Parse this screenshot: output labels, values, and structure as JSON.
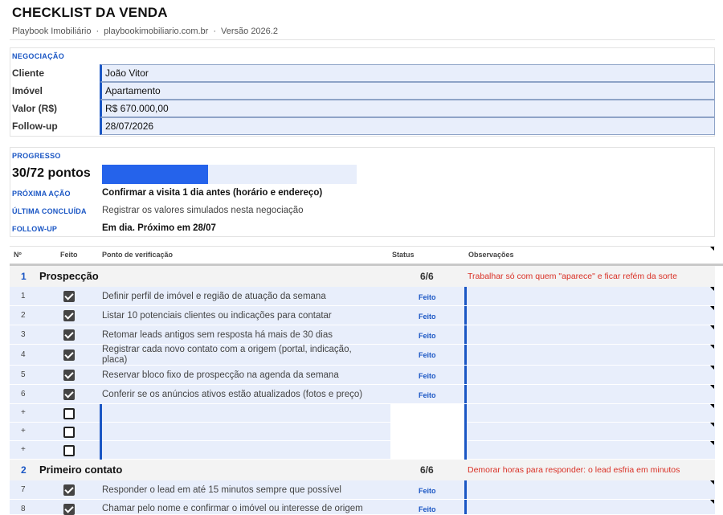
{
  "header": {
    "title": "CHECKLIST DA VENDA",
    "brand": "Playbook Imobiliário",
    "site": "playbookimobiliario.com.br",
    "version": "Versão 2026.2",
    "separator": "·"
  },
  "negociacao": {
    "label": "NEGOCIAÇÃO",
    "fields": [
      {
        "label": "Cliente",
        "value": "João Vitor"
      },
      {
        "label": "Imóvel",
        "value": "Apartamento"
      },
      {
        "label": "Valor (R$)",
        "value": "R$ 670.000,00"
      },
      {
        "label": "Follow-up",
        "value": "28/07/2026"
      }
    ]
  },
  "progresso": {
    "label": "PROGRESSO",
    "points": "30/72 pontos",
    "fraction": 0.4167,
    "proxima_acao_label": "PRÓXIMA AÇÃO",
    "proxima_acao": "Confirmar a visita 1 dia antes (horário e endereço)",
    "ultima_label": "ÚLTIMA CONCLUÍDA",
    "ultima": "Registrar os valores simulados nesta negociação",
    "followup_label": "FOLLOW-UP",
    "followup": "Em dia. Próximo em 28/07"
  },
  "table": {
    "headers": {
      "num": "Nº",
      "feito": "Feito",
      "ponto": "Ponto de verificação",
      "status": "Status",
      "obs": "Observações"
    },
    "groups": [
      {
        "num": "1",
        "name": "Prospecção",
        "score": "6/6",
        "warning": "Trabalhar só com quem \"aparece\" e ficar refém da sorte",
        "items": [
          {
            "n": "1",
            "text": "Definir perfil de imóvel e região de atuação da semana",
            "status": "Feito"
          },
          {
            "n": "2",
            "text": "Listar 10 potenciais clientes ou indicações para contatar",
            "status": "Feito"
          },
          {
            "n": "3",
            "text": "Retomar leads antigos sem resposta há mais de 30 dias",
            "status": "Feito"
          },
          {
            "n": "4",
            "text": "Registrar cada novo contato com a origem (portal, indicação, placa)",
            "status": "Feito"
          },
          {
            "n": "5",
            "text": "Reservar bloco fixo de prospecção na agenda da semana",
            "status": "Feito"
          },
          {
            "n": "6",
            "text": "Conferir se os anúncios ativos estão atualizados (fotos e preço)",
            "status": "Feito"
          }
        ],
        "empty_rows": [
          "+",
          "+",
          "+"
        ]
      },
      {
        "num": "2",
        "name": "Primeiro contato",
        "score": "6/6",
        "warning": "Demorar horas para responder: o lead esfria em minutos",
        "items": [
          {
            "n": "7",
            "text": "Responder o lead em até 15 minutos sempre que possível",
            "status": "Feito"
          },
          {
            "n": "8",
            "text": "Chamar pelo nome e confirmar o imóvel ou interesse de origem",
            "status": "Feito"
          }
        ]
      }
    ]
  },
  "icons": {
    "checked": "checkbox-checked-icon",
    "unchecked": "checkbox-empty-icon",
    "note": "comment-corner-icon"
  },
  "colors": {
    "accent": "#1a56c4",
    "progress": "#2563eb",
    "cell_fill": "#e8eefb",
    "warning": "#d93025"
  }
}
